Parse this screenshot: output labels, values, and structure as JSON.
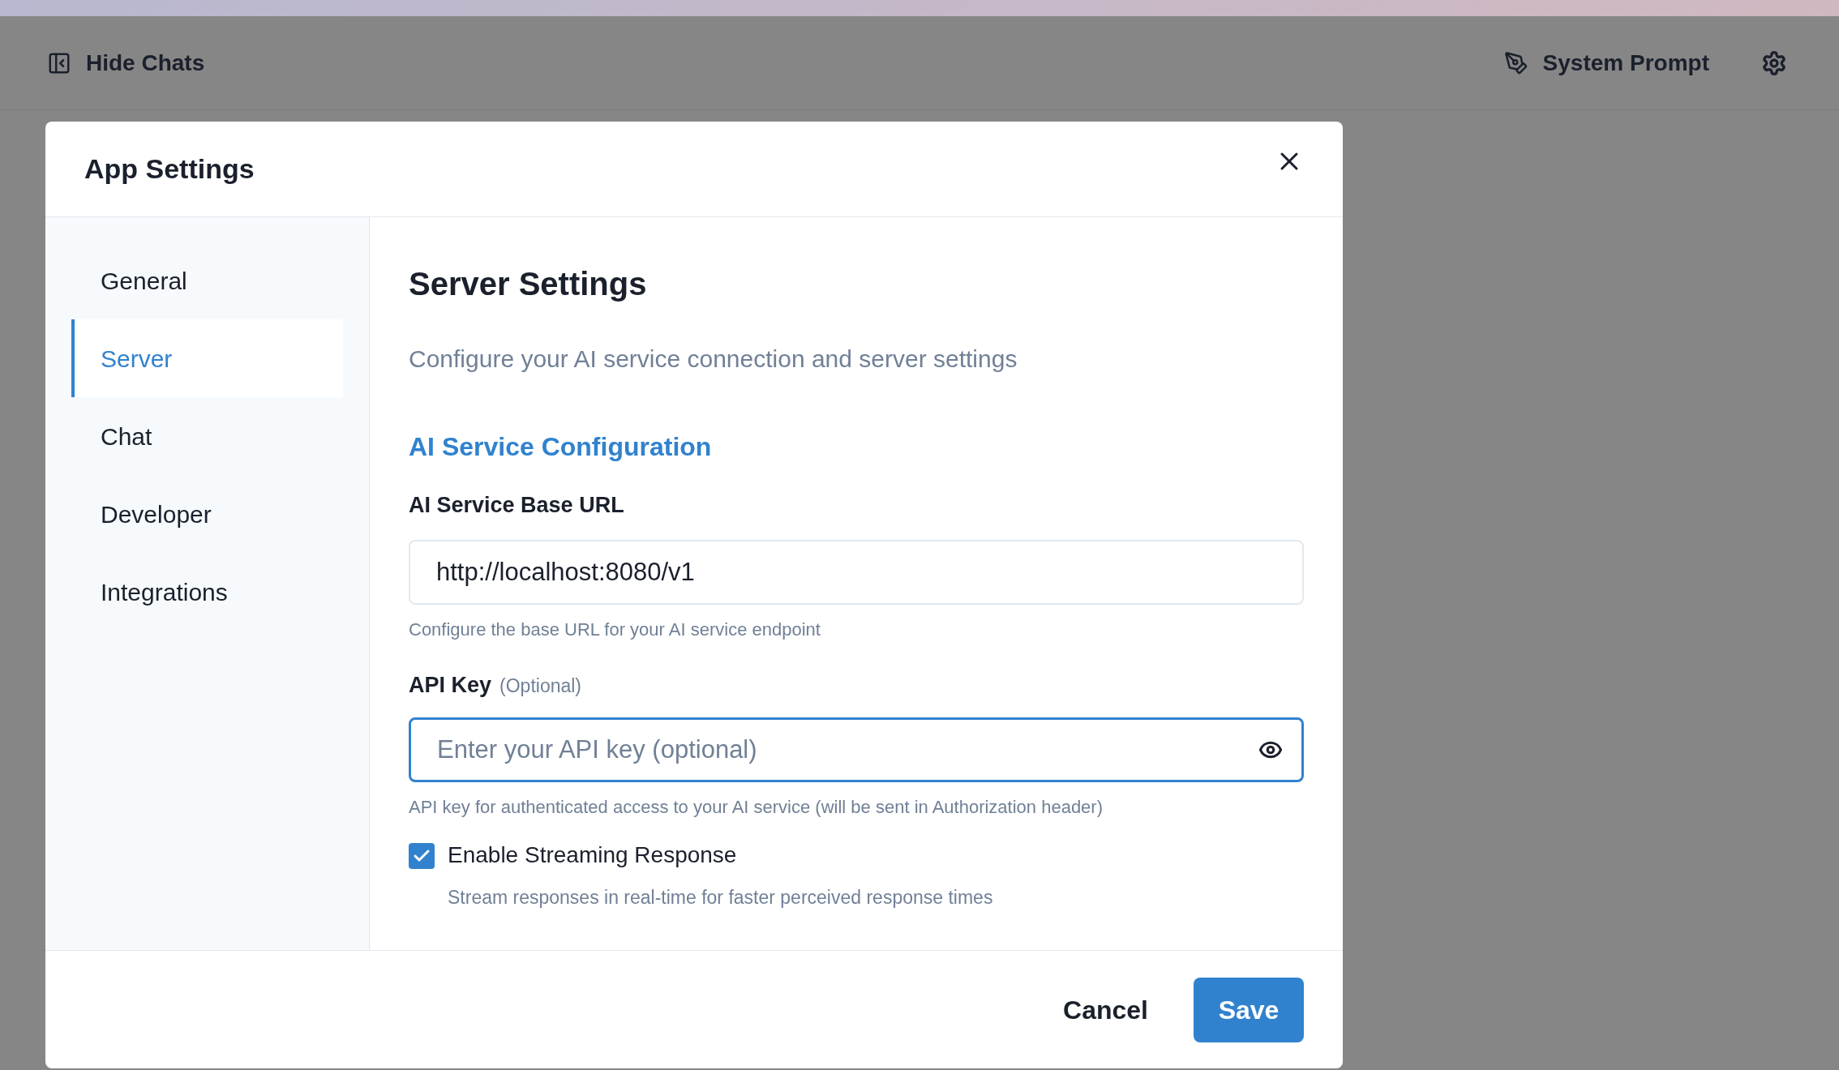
{
  "top_bar": {
    "hide_chats": "Hide Chats",
    "system_prompt": "System Prompt"
  },
  "dialog": {
    "title": "App Settings",
    "nav": [
      {
        "label": "General",
        "selected": false
      },
      {
        "label": "Server",
        "selected": true
      },
      {
        "label": "Chat",
        "selected": false
      },
      {
        "label": "Developer",
        "selected": false
      },
      {
        "label": "Integrations",
        "selected": false
      }
    ],
    "heading": "Server Settings",
    "description": "Configure your AI service connection and server settings",
    "section": "AI Service Configuration",
    "base_url": {
      "label": "AI Service Base URL",
      "value": "http://localhost:8080/v1",
      "help": "Configure the base URL for your AI service endpoint"
    },
    "api_key": {
      "label": "API Key",
      "optional": "(Optional)",
      "placeholder": "Enter your API key (optional)",
      "help": "API key for authenticated access to your AI service (will be sent in Authorization header)",
      "focused": true
    },
    "streaming": {
      "label": "Enable Streaming Response",
      "help": "Stream responses in real-time for faster perceived response times",
      "checked": true
    },
    "buttons": {
      "cancel": "Cancel",
      "save": "Save"
    }
  }
}
